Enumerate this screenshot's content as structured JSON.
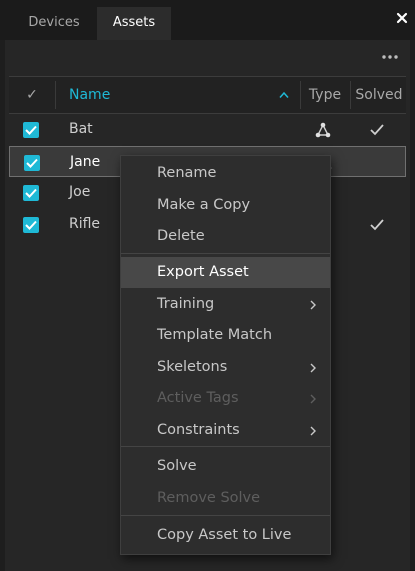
{
  "tabs": [
    {
      "label": "Devices",
      "active": false
    },
    {
      "label": "Assets",
      "active": true
    }
  ],
  "icons": {
    "close": "close-icon",
    "more": "more-icon",
    "sort": "sort-ascending-icon",
    "type": "skeleton-icon",
    "solved": "checkmark-icon",
    "checkbox": "checkbox-checked-icon",
    "submenu": "chevron-right-icon"
  },
  "colors": {
    "accent": "#1fb9d6",
    "panel": "#262626",
    "menu": "#2d2d2d",
    "highlight": "#484848"
  },
  "table": {
    "columns": {
      "check": "✓",
      "name": "Name",
      "type": "Type",
      "solved": "Solved"
    },
    "rows": [
      {
        "name": "Bat",
        "checked": true,
        "selected": false,
        "has_type": true,
        "solved": true
      },
      {
        "name": "Jane",
        "checked": true,
        "selected": true,
        "has_type": true,
        "solved": false
      },
      {
        "name": "Joe",
        "checked": true,
        "selected": false,
        "has_type": false,
        "solved": false
      },
      {
        "name": "Rifle",
        "checked": true,
        "selected": false,
        "has_type": false,
        "solved": true
      }
    ]
  },
  "context_menu": {
    "items": [
      {
        "label": "Rename",
        "enabled": true
      },
      {
        "label": "Make a Copy",
        "enabled": true
      },
      {
        "label": "Delete",
        "enabled": true
      },
      {
        "label": "Export Asset",
        "enabled": true,
        "highlighted": true
      },
      {
        "label": "Training",
        "enabled": true,
        "submenu": true
      },
      {
        "label": "Template Match",
        "enabled": true
      },
      {
        "label": "Skeletons",
        "enabled": true,
        "submenu": true
      },
      {
        "label": "Active Tags",
        "enabled": false,
        "submenu": true
      },
      {
        "label": "Constraints",
        "enabled": true,
        "submenu": true
      },
      {
        "label": "Solve",
        "enabled": true
      },
      {
        "label": "Remove Solve",
        "enabled": false
      },
      {
        "label": "Copy Asset to Live",
        "enabled": true
      }
    ]
  }
}
